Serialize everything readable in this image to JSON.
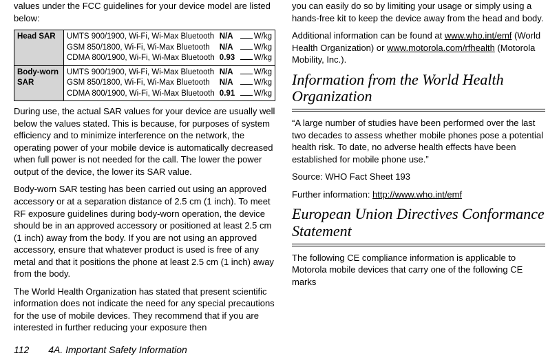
{
  "left": {
    "intro": "values under the FCC guidelines for your device model are listed below:",
    "table": {
      "head_label": "Head SAR",
      "body_label": "Body-worn SAR",
      "tech1": "UMTS 900/1900, Wi-Fi, Wi-Max Bluetooth",
      "tech2": "GSM 850/1800, Wi-Fi, Wi-Max Bluetooth",
      "tech3": "CDMA 800/1900, Wi-Fi, Wi-Max Bluetooth",
      "na": "N/A",
      "head_val3": "0.93",
      "body_val3": "0.91",
      "unit": "W/kg"
    },
    "p1": "During use, the actual SAR values for your device are usually well below the values stated. This is because, for purposes of system efficiency and to minimize interference on the network, the operating power of your mobile device is automatically decreased when full power is not needed for the call. The lower the power output of the device, the lower its SAR value.",
    "p2": "Body-worn SAR testing has been carried out using an approved accessory or at a separation distance of 2.5 cm (1 inch). To meet RF exposure guidelines during body-worn operation, the device should be in an approved accessory or positioned at least 2.5 cm (1 inch) away from the body.  If you are not using an approved accessory, ensure that whatever product is used is free of any metal and that it positions the phone at least 2.5 cm (1 inch) away from the body.",
    "p3": "The World Health Organization has stated that present scientific information does not indicate the need for any special precautions for the use of mobile devices. They recommend that if you are interested in further reducing your exposure then"
  },
  "right": {
    "p1a": "you can easily do so by limiting your usage or simply using a hands-free kit to keep the device away from the head and body.",
    "p1b_prefix": "Additional information can be found at ",
    "link1": "www.who.int/emf",
    "p1b_mid": " (World Health Organization) or ",
    "link2": "www.motorola.com/rfhealth",
    "p1b_suffix": " (Motorola Mobility, Inc.).",
    "h1": "Information from the World Health Organization",
    "p2": "“A large number of studies have been performed over the last two decades to assess whether mobile phones pose a potential health risk. To date, no adverse health effects have been established for mobile phone use.”",
    "p3": "Source: WHO Fact Sheet 193",
    "p4a": "Further information: ",
    "link3": "http://www.who.int/emf",
    "h2": "European Union Directives Conformance Statement",
    "p5": "The following CE compliance information is applicable to Motorola mobile devices that carry one of the following CE marks"
  },
  "footer": {
    "page": "112",
    "section": "4A. Important Safety Information"
  }
}
